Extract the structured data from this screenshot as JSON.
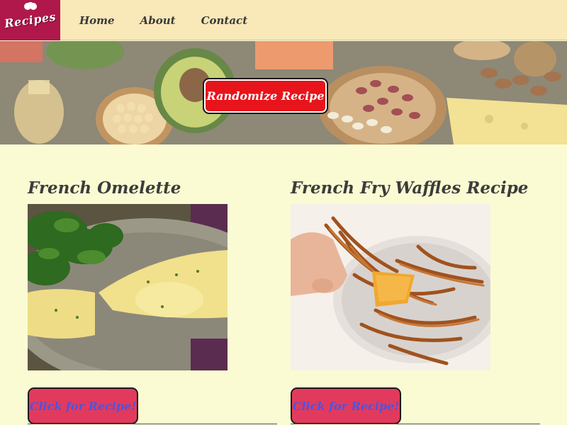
{
  "logo": {
    "text": "Recipes"
  },
  "nav": {
    "links": [
      {
        "label": "Home"
      },
      {
        "label": "About"
      },
      {
        "label": "Contact"
      }
    ]
  },
  "hero": {
    "randomize_label": "Randomize Recipe"
  },
  "recipes": [
    {
      "title": "French Omelette",
      "button_label": "Click for Recipe!"
    },
    {
      "title": "French Fry Waffles Recipe",
      "button_label": "Click for Recipe!"
    }
  ],
  "colors": {
    "background": "#fbfbd3",
    "navbar": "#f9e8b8",
    "logo_bg": "#b0174b",
    "randomize_button": "#e8141b",
    "recipe_button": "#e23a5d",
    "recipe_button_text": "#4a55e0"
  }
}
